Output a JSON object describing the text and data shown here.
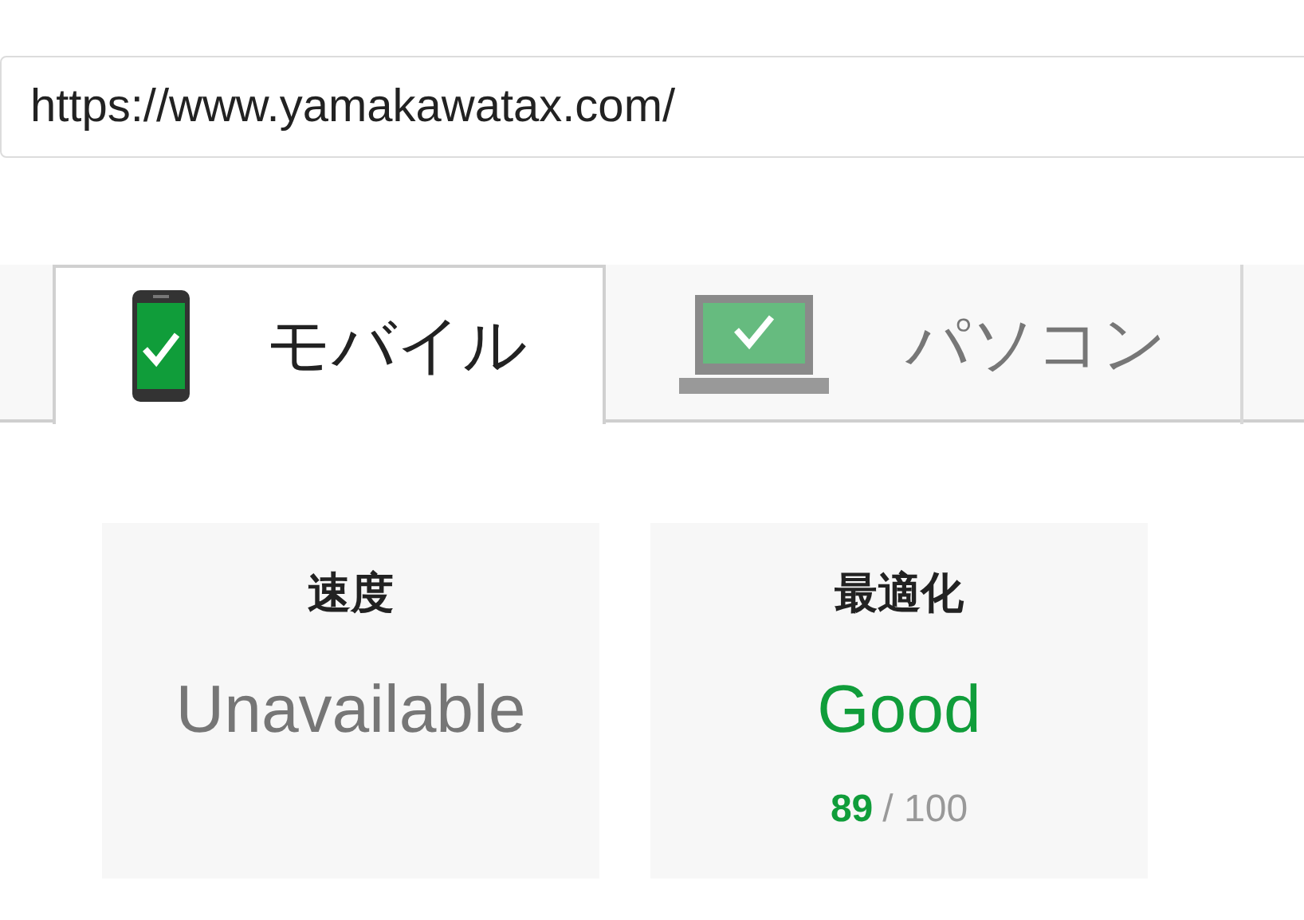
{
  "url_field": {
    "value": "https://www.yamakawatax.com/"
  },
  "tabs": [
    {
      "label": "モバイル",
      "kind": "phone",
      "selected": true
    },
    {
      "label": "パソコン",
      "kind": "laptop",
      "selected": false
    }
  ],
  "cards": [
    {
      "title": "速度",
      "rating": "Unavailable",
      "good": false
    },
    {
      "title": "最適化",
      "rating": "Good",
      "good": true,
      "score": "89",
      "max": "/ 100"
    }
  ]
}
